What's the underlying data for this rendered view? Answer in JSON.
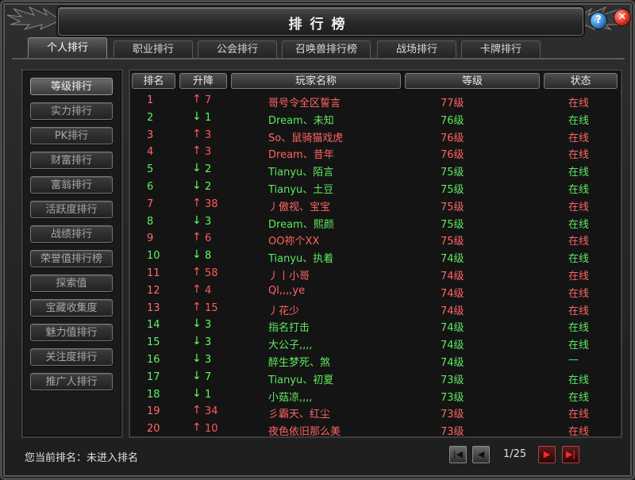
{
  "window": {
    "title": "排行榜"
  },
  "tabs": [
    {
      "label": "个人排行",
      "active": true
    },
    {
      "label": "职业排行"
    },
    {
      "label": "公会排行"
    },
    {
      "label": "召唤兽排行榜"
    },
    {
      "label": "战场排行"
    },
    {
      "label": "卡牌排行"
    }
  ],
  "sidebar": [
    "等级排行",
    "实力排行",
    "PK排行",
    "财富排行",
    "富翁排行",
    "活跃度排行",
    "战绩排行",
    "荣誉值排行榜",
    "探索值",
    "宝藏收集度",
    "魅力值排行",
    "关注度排行",
    "推广人排行"
  ],
  "table": {
    "headers": [
      "排名",
      "升降",
      "玩家名称",
      "等级",
      "状态"
    ],
    "rows": [
      {
        "rank": "1",
        "dir": "up",
        "arrow": "↑",
        "change": "7",
        "name": "哥号令全区誓言",
        "level": "77级",
        "status": "在线"
      },
      {
        "rank": "2",
        "dir": "down",
        "arrow": "↓",
        "change": "1",
        "name": "Dream、未知",
        "level": "76级",
        "status": "在线"
      },
      {
        "rank": "3",
        "dir": "up",
        "arrow": "↑",
        "change": "3",
        "name": "So、鼠骑猫戏虎",
        "level": "76级",
        "status": "在线"
      },
      {
        "rank": "4",
        "dir": "up",
        "arrow": "↑",
        "change": "3",
        "name": "Dream、昔年",
        "level": "76级",
        "status": "在线"
      },
      {
        "rank": "5",
        "dir": "down",
        "arrow": "↓",
        "change": "2",
        "name": "Tianyu、陌言",
        "level": "75级",
        "status": "在线"
      },
      {
        "rank": "6",
        "dir": "down",
        "arrow": "↓",
        "change": "2",
        "name": "Tianyu、土豆",
        "level": "75级",
        "status": "在线"
      },
      {
        "rank": "7",
        "dir": "up",
        "arrow": "↑",
        "change": "38",
        "name": "丿傲视、宝宝",
        "level": "75级",
        "status": "在线"
      },
      {
        "rank": "8",
        "dir": "down",
        "arrow": "↓",
        "change": "3",
        "name": "Dream、熙颜",
        "level": "75级",
        "status": "在线"
      },
      {
        "rank": "9",
        "dir": "up",
        "arrow": "↑",
        "change": "6",
        "name": "OO祢个XX",
        "level": "75级",
        "status": "在线"
      },
      {
        "rank": "10",
        "dir": "down",
        "arrow": "↓",
        "change": "8",
        "name": "Tianyu、执着",
        "level": "74级",
        "status": "在线"
      },
      {
        "rank": "11",
        "dir": "up",
        "arrow": "↑",
        "change": "58",
        "name": "丿丨小哥",
        "level": "74级",
        "status": "在线"
      },
      {
        "rank": "12",
        "dir": "up",
        "arrow": "↑",
        "change": "4",
        "name": "Ql,,,,ye",
        "level": "74级",
        "status": "在线"
      },
      {
        "rank": "13",
        "dir": "up",
        "arrow": "↑",
        "change": "15",
        "name": "丿花少",
        "level": "74级",
        "status": "在线"
      },
      {
        "rank": "14",
        "dir": "down",
        "arrow": "↓",
        "change": "3",
        "name": "指名打击",
        "level": "74级",
        "status": "在线"
      },
      {
        "rank": "15",
        "dir": "down",
        "arrow": "↓",
        "change": "3",
        "name": "大公子,,,,",
        "level": "74级",
        "status": "在线"
      },
      {
        "rank": "16",
        "dir": "down",
        "arrow": "↓",
        "change": "3",
        "name": "醉生梦死、煞",
        "level": "74级",
        "status": "—"
      },
      {
        "rank": "17",
        "dir": "down",
        "arrow": "↓",
        "change": "7",
        "name": "Tianyu、初夏",
        "level": "73级",
        "status": "在线"
      },
      {
        "rank": "18",
        "dir": "down",
        "arrow": "↓",
        "change": "1",
        "name": "小菇凉,,,,",
        "level": "73级",
        "status": "在线"
      },
      {
        "rank": "19",
        "dir": "up",
        "arrow": "↑",
        "change": "34",
        "name": "彡霸天、红尘",
        "level": "73级",
        "status": "在线"
      },
      {
        "rank": "20",
        "dir": "up",
        "arrow": "↑",
        "change": "10",
        "name": "夜色依旧那么美",
        "level": "73级",
        "status": "在线"
      }
    ]
  },
  "footer": {
    "current_rank_label": "您当前排名：未进入排名",
    "page": "1/25",
    "first_icon": "first-page-icon",
    "prev_icon": "prev-page-icon",
    "next_icon": "next-page-icon",
    "last_icon": "last-page-icon"
  },
  "colors": {
    "up": "#ff5a5a",
    "down": "#5cff5c",
    "status_online_red": "#ff6464",
    "status_online_green": "#5fe85f"
  },
  "icons": {
    "help": "?",
    "close": "✕"
  }
}
